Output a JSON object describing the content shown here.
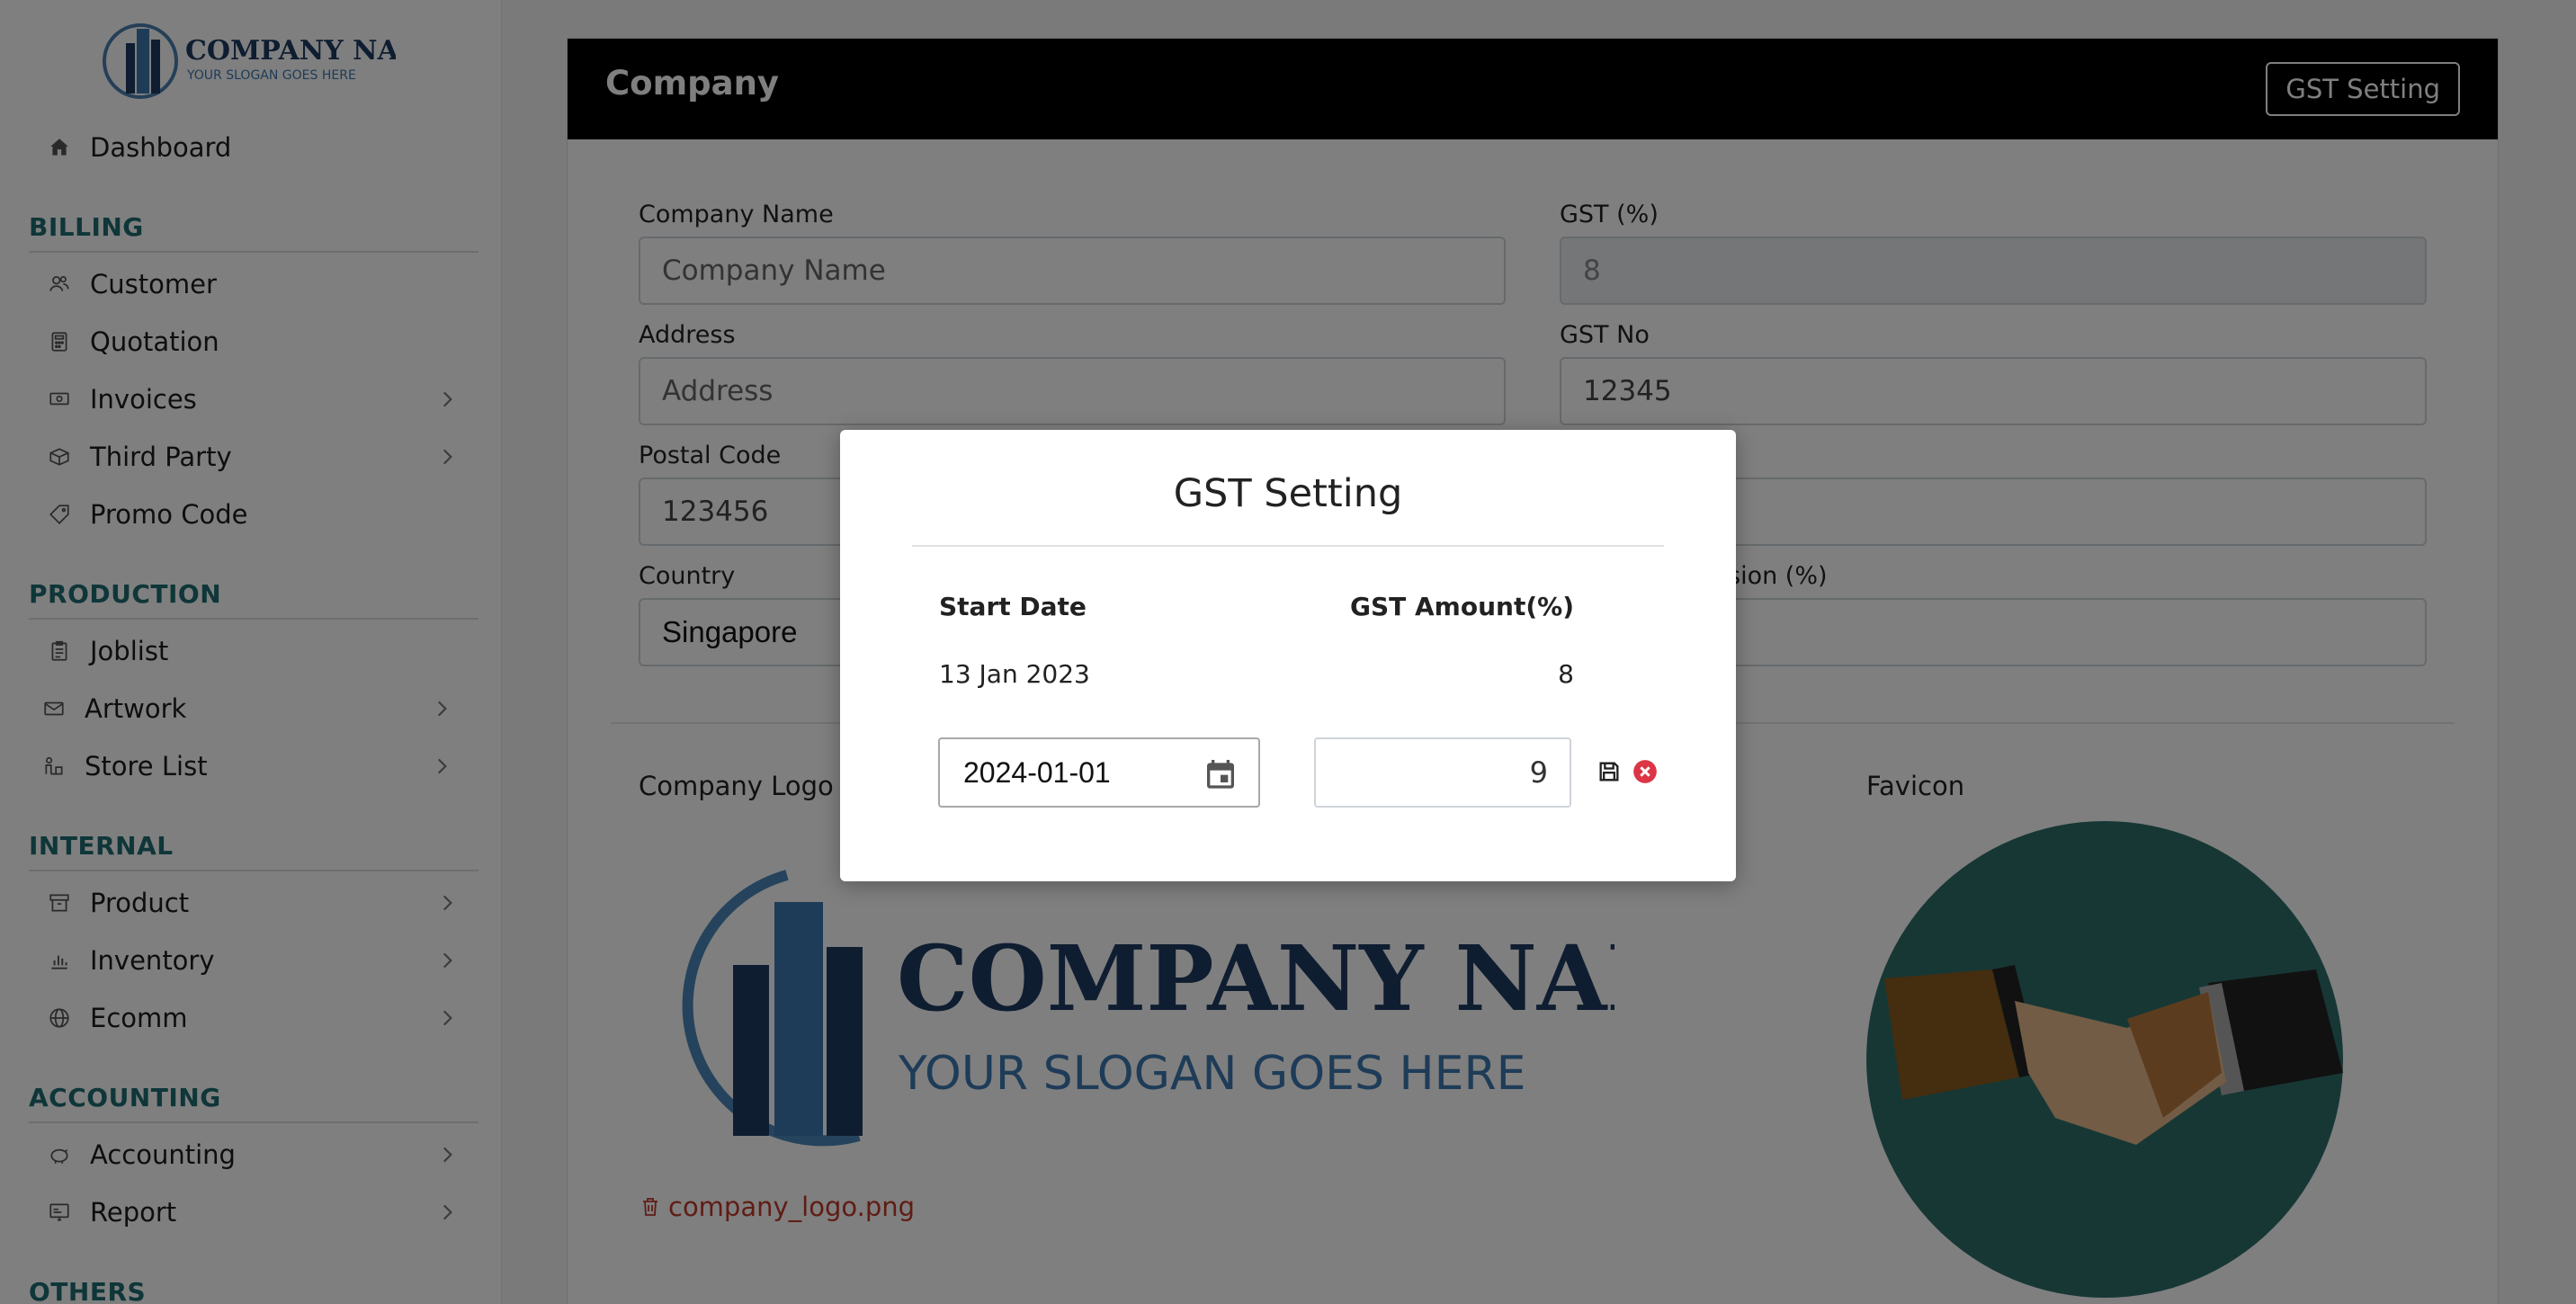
{
  "sidebar": {
    "logo": {
      "name": "COMPANY NAME",
      "slogan": "YOUR SLOGAN GOES HERE"
    },
    "dashboard": {
      "label": "Dashboard",
      "icon": "home-icon"
    },
    "sections": [
      {
        "title": "BILLING",
        "items": [
          {
            "label": "Customer",
            "icon": "users-icon",
            "has_children": false
          },
          {
            "label": "Quotation",
            "icon": "calculator-icon",
            "has_children": false
          },
          {
            "label": "Invoices",
            "icon": "money-icon",
            "has_children": true
          },
          {
            "label": "Third Party",
            "icon": "box-icon",
            "has_children": true
          },
          {
            "label": "Promo Code",
            "icon": "tag-icon",
            "has_children": false
          }
        ]
      },
      {
        "title": "PRODUCTION",
        "items": [
          {
            "label": "Joblist",
            "icon": "clipboard-icon",
            "has_children": false
          },
          {
            "label": "Artwork",
            "icon": "envelope-icon",
            "has_children": true
          },
          {
            "label": "Store List",
            "icon": "store-icon",
            "has_children": true
          }
        ]
      },
      {
        "title": "INTERNAL",
        "items": [
          {
            "label": "Product",
            "icon": "archive-icon",
            "has_children": true
          },
          {
            "label": "Inventory",
            "icon": "bar-chart-icon",
            "has_children": true
          },
          {
            "label": "Ecomm",
            "icon": "globe-icon",
            "has_children": true
          }
        ]
      },
      {
        "title": "ACCOUNTING",
        "items": [
          {
            "label": "Accounting",
            "icon": "piggy-bank-icon",
            "has_children": true
          },
          {
            "label": "Report",
            "icon": "report-icon",
            "has_children": true
          }
        ]
      },
      {
        "title": "OTHERS",
        "items": []
      }
    ]
  },
  "card": {
    "title": "Company",
    "gst_button": "GST Setting",
    "fields": {
      "company_name": {
        "label": "Company Name",
        "placeholder": "Company Name"
      },
      "gst_percent": {
        "label": "GST (%)",
        "value": "8"
      },
      "address": {
        "label": "Address",
        "placeholder": "Address"
      },
      "gst_no": {
        "label": "GST No",
        "value": "12345"
      },
      "postal_code": {
        "label": "Postal Code",
        "value": "123456"
      },
      "country": {
        "label": "Country",
        "value": "Singapore"
      },
      "commission": {
        "label_partial": "sion (%)"
      }
    },
    "company_logo_label": "Company Logo",
    "logo_file": "company_logo.png",
    "favicon_label": "Favicon"
  },
  "modal": {
    "title": "GST Setting",
    "col_start_date": "Start Date",
    "col_gst_amount": "GST Amount(%)",
    "rows": [
      {
        "start_date": "13 Jan 2023",
        "gst_amount": "8"
      }
    ],
    "new_date": "2024-01-01",
    "new_amount": "9"
  },
  "colors": {
    "accent": "#1e6c72",
    "header": "#000000",
    "danger": "#dc3545",
    "logo_blue": "#1f3b63"
  }
}
